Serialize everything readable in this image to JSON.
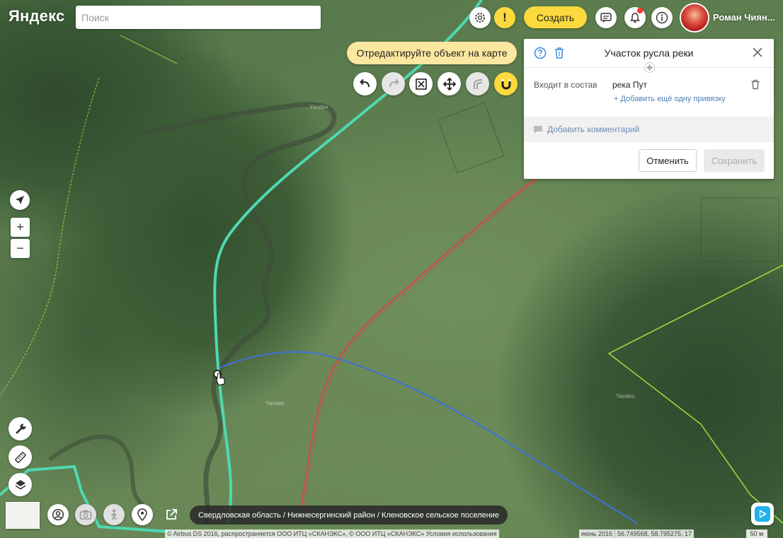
{
  "header": {
    "logo": "Яндекс",
    "search_placeholder": "Поиск",
    "create_label": "Создать",
    "username": "Роман Чиян..."
  },
  "editor": {
    "hint": "Отредактируйте объект на карте",
    "tools": [
      "undo-icon",
      "redo-icon",
      "crop-frame-icon",
      "move-arrows-icon",
      "branch-icon",
      "magnet-icon"
    ]
  },
  "panel": {
    "title": "Участок русла реки",
    "part_of_label": "Входит в состав",
    "part_of_value": "река Пут",
    "add_link": "+ Добавить ещё одну привязку",
    "add_comment": "Добавить комментарий",
    "cancel_label": "Отменить",
    "save_label": "Сохранить"
  },
  "map_controls": {
    "zoom_in": "+",
    "zoom_out": "−"
  },
  "map_labels": {
    "label_a": "Yandex",
    "label_b": "Yandex",
    "label_c": "Yandex"
  },
  "footer": {
    "breadcrumb": "Свердловская область / Нижнесергинский район / Кленовское сельское поселение",
    "copyright": "© Airbus DS 2016, распространяется ООО ИТЦ «СКАНЭКС», © ООО ИТЦ «СКАНЭКС» Условия использования",
    "imagery_date": "июнь 2016",
    "coordinates": "56.749568, 58.795275, 17",
    "scale": "50 м"
  },
  "colors": {
    "accent_yellow": "#fcd93d",
    "hint_yellow": "#fce7a0",
    "selected_line": "#4fd8b2",
    "river_blue": "#3f72d8",
    "road_red": "#c8504a",
    "boundary_green": "#9be03c"
  }
}
